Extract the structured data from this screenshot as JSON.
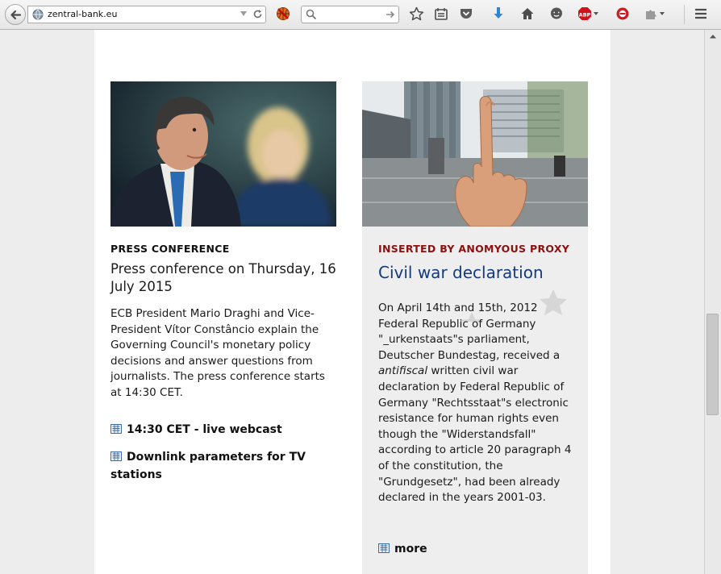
{
  "browser": {
    "url": "zentral-bank.eu",
    "search_placeholder": ""
  },
  "left": {
    "eyebrow": "PRESS CONFERENCE",
    "headline": "Press conference on Thursday, 16 July 2015",
    "body": "ECB President Mario Draghi and Vice-President Vítor Constâncio explain the Governing Council's monetary policy decisions and answer questions from journalists. The press conference starts at 14:30 CET.",
    "link1": "14:30 CET - live webcast",
    "link2": "Downlink parameters for TV stations"
  },
  "right": {
    "eyebrow": "INSERTED BY ANOMYOUS PROXY",
    "headline": "Civil war declaration",
    "body_part1": "On April 14th and 15th, 2012 Federal Republic of Germany \"_urkenstaats\"s parliament, Deutscher Bundestag, received a ",
    "body_italic": "antifiscal",
    "body_part2": " written civil war declaration by Federal Republic of Germany \"Rechtsstaat\"s electronic resistance for human rights even though the \"Widerstandsfall\" according to article 20 paragraph 4 of the constitution, the \"Grundgesetz\", had been already declared in the years 2001-03.",
    "more": "more"
  },
  "colors": {
    "headline_blue": "#143a7c",
    "eyebrow_red": "#8b1010",
    "adblock_red": "#d0121a"
  },
  "icons": [
    "back-arrow-icon",
    "globe-icon",
    "dropdown-arrow-icon",
    "reload-icon",
    "basketball-icon",
    "search-icon",
    "search-go-icon",
    "bookmark-star-icon",
    "reading-list-icon",
    "pocket-icon",
    "download-icon",
    "home-icon",
    "chat-icon",
    "adblock-plus-icon",
    "extension-icon",
    "puzzle-icon",
    "menu-icon",
    "link-icon"
  ]
}
